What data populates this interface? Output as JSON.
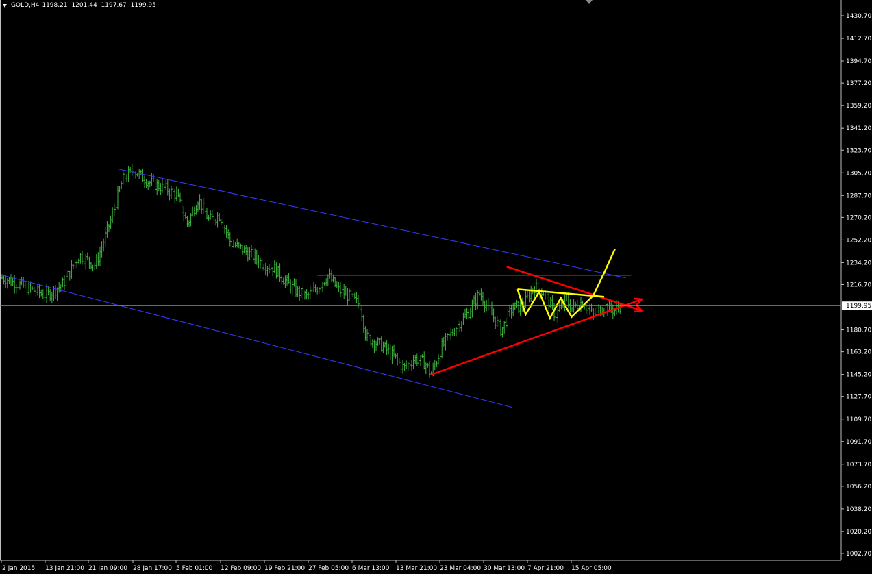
{
  "header": {
    "symbol": "GOLD,H4",
    "open": "1198.21",
    "high": "1201.44",
    "low": "1197.67",
    "close": "1199.95"
  },
  "colors": {
    "background": "#000000",
    "grid_frame": "#c0c0c0",
    "candles": "#3fb83f",
    "channel": "#3a3aff",
    "bid_line": "#8a8aa0",
    "trend_red": "#ff0000",
    "pattern_yellow": "#ffff00",
    "price_tag_bg": "#ffffff",
    "price_tag_text": "#000000"
  },
  "current_price": "1199.95",
  "chart_data": {
    "type": "candlestick",
    "price_axis": {
      "ticks": [
        "1430.70",
        "1412.70",
        "1394.70",
        "1377.20",
        "1359.20",
        "1341.20",
        "1323.70",
        "1305.70",
        "1287.70",
        "1270.20",
        "1252.20",
        "1234.20",
        "1216.70",
        "1199.95",
        "1180.70",
        "1163.20",
        "1145.20",
        "1127.70",
        "1109.70",
        "1091.70",
        "1073.70",
        "1056.20",
        "1038.20",
        "1020.20",
        "1002.70"
      ],
      "range": [
        1002.7,
        1430.7
      ]
    },
    "time_axis": {
      "ticks": [
        "2 Jan 2015",
        "13 Jan 21:00",
        "21 Jan 09:00",
        "28 Jan 17:00",
        "5 Feb 01:00",
        "12 Feb 09:00",
        "19 Feb 21:00",
        "27 Feb 05:00",
        "6 Mar 13:00",
        "13 Mar 21:00",
        "23 Mar 04:00",
        "30 Mar 13:00",
        "7 Apr 21:00",
        "15 Apr 05:00"
      ]
    },
    "price_path": [
      [
        0,
        1222
      ],
      [
        5,
        1213
      ],
      [
        8,
        1208
      ],
      [
        11,
        1217
      ],
      [
        14,
        1240
      ],
      [
        17,
        1232
      ],
      [
        20,
        1270
      ],
      [
        22,
        1300
      ],
      [
        24,
        1308
      ],
      [
        27,
        1298
      ],
      [
        30,
        1293
      ],
      [
        32,
        1288
      ],
      [
        34,
        1265
      ],
      [
        36,
        1285
      ],
      [
        38,
        1268
      ],
      [
        40,
        1272
      ],
      [
        42,
        1250
      ],
      [
        44,
        1245
      ],
      [
        46,
        1240
      ],
      [
        48,
        1233
      ],
      [
        50,
        1230
      ],
      [
        52,
        1220
      ],
      [
        54,
        1212
      ],
      [
        56,
        1207
      ],
      [
        58,
        1214
      ],
      [
        60,
        1224
      ],
      [
        62,
        1212
      ],
      [
        64,
        1207
      ],
      [
        66,
        1200
      ],
      [
        67,
        1175
      ],
      [
        70,
        1168
      ],
      [
        72,
        1160
      ],
      [
        74,
        1150
      ],
      [
        76,
        1158
      ],
      [
        78,
        1154
      ],
      [
        79,
        1145
      ],
      [
        81,
        1167
      ],
      [
        84,
        1185
      ],
      [
        86,
        1195
      ],
      [
        88,
        1210
      ],
      [
        90,
        1195
      ],
      [
        92,
        1180
      ],
      [
        94,
        1198
      ],
      [
        96,
        1200
      ],
      [
        98,
        1215
      ],
      [
        100,
        1210
      ],
      [
        102,
        1192
      ],
      [
        104,
        1205
      ],
      [
        105,
        1198
      ],
      [
        107,
        1203
      ],
      [
        109,
        1192
      ],
      [
        111,
        1200
      ],
      [
        113,
        1196
      ],
      [
        114,
        1200
      ]
    ],
    "drawings": {
      "channel_upper": [
        [
          21,
          1309
        ],
        [
          115,
          1222
        ]
      ],
      "channel_lower": [
        [
          0,
          1224
        ],
        [
          94,
          1119
        ]
      ],
      "horizontal_resistance": [
        [
          58,
          1224
        ],
        [
          116,
          1224
        ]
      ],
      "red_resistance": [
        [
          93,
          1231
        ],
        [
          118,
          1196
        ],
        "arrow"
      ],
      "red_support": [
        [
          79,
          1145
        ],
        [
          118,
          1205
        ],
        "arrow"
      ],
      "yellow_pattern": [
        [
          95,
          1213
        ],
        [
          96.5,
          1193
        ],
        [
          99,
          1211
        ],
        [
          101,
          1190
        ],
        [
          103,
          1206
        ],
        [
          105,
          1191
        ],
        [
          109,
          1208
        ],
        [
          111,
          1226
        ],
        [
          113,
          1245
        ]
      ],
      "yellow_top": [
        [
          95,
          1213
        ],
        [
          111,
          1207
        ]
      ]
    }
  }
}
